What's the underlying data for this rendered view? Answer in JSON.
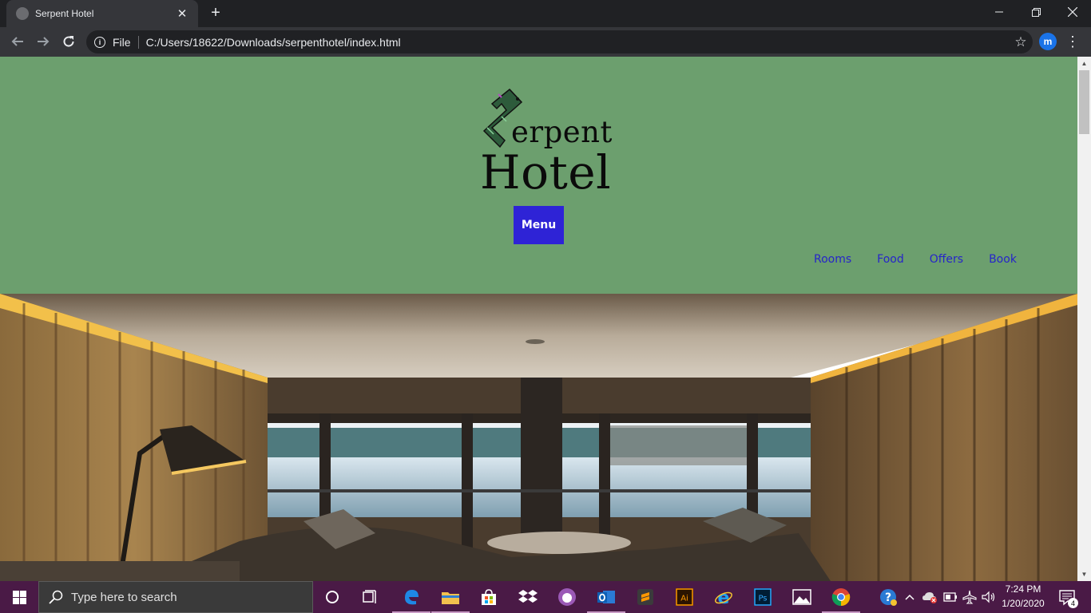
{
  "browser": {
    "tab_title": "Serpent Hotel",
    "new_tab_label": "+",
    "close_tab_label": "✕",
    "url_scheme": "File",
    "url": "C:/Users/18622/Downloads/serpenthotel/index.html",
    "profile_initial": "m"
  },
  "site": {
    "logo_line1": "erpent",
    "logo_line2": "Hotel",
    "menu_button": "Menu",
    "nav": [
      "Rooms",
      "Food",
      "Offers",
      "Book"
    ]
  },
  "taskbar": {
    "search_placeholder": "Type here to search",
    "time": "7:24 PM",
    "date": "1/20/2020",
    "notification_count": "4",
    "pinned": [
      "cortana-icon",
      "task-view-icon",
      "edge-icon",
      "file-explorer-icon",
      "store-icon",
      "dropbox-icon",
      "github-desktop-icon",
      "outlook-icon",
      "sublime-text-icon",
      "illustrator-icon",
      "internet-explorer-icon",
      "photoshop-icon",
      "photos-icon",
      "chrome-icon"
    ]
  },
  "colors": {
    "header_bg": "#6c9f6e",
    "menu_button_bg": "#2e23d6",
    "nav_link": "#2624c9",
    "taskbar_bg": "#4a1a46"
  }
}
